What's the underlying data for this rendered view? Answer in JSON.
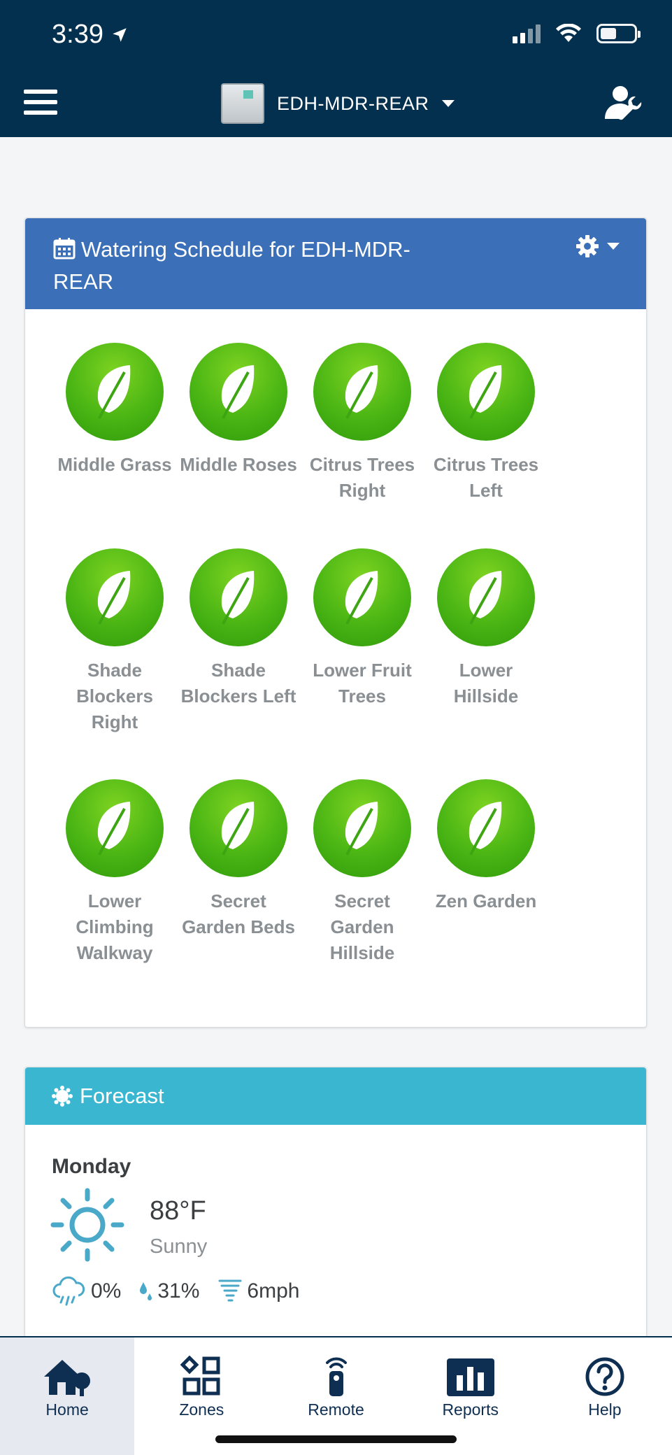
{
  "status_bar": {
    "time": "3:39"
  },
  "nav": {
    "controller_name": "EDH-MDR-REAR"
  },
  "schedule": {
    "title": "Watering Schedule for EDH-MDR-REAR",
    "zones": [
      {
        "label": "Middle Grass"
      },
      {
        "label": "Middle Roses"
      },
      {
        "label": "Citrus Trees Right"
      },
      {
        "label": "Citrus Trees Left"
      },
      {
        "label": "Shade Blockers Right"
      },
      {
        "label": "Shade Blockers Left"
      },
      {
        "label": "Lower Fruit Trees"
      },
      {
        "label": "Lower Hillside"
      },
      {
        "label": "Lower Climbing Walkway"
      },
      {
        "label": "Secret Garden Beds"
      },
      {
        "label": "Secret Garden Hillside"
      },
      {
        "label": "Zen Garden"
      }
    ]
  },
  "forecast": {
    "title": "Forecast",
    "day": "Monday",
    "temperature": "88°F",
    "condition": "Sunny",
    "precip": "0%",
    "humidity": "31%",
    "wind": "6mph"
  },
  "tabs": [
    {
      "label": "Home",
      "icon": "home-icon",
      "active": true
    },
    {
      "label": "Zones",
      "icon": "zones-icon"
    },
    {
      "label": "Remote",
      "icon": "remote-icon"
    },
    {
      "label": "Reports",
      "icon": "reports-icon"
    },
    {
      "label": "Help",
      "icon": "help-icon"
    }
  ],
  "colors": {
    "nav_bg": "#04304f",
    "schedule_header": "#3b6fb7",
    "forecast_header": "#3ab6d0",
    "zone_green": "#4ab514",
    "weather_icon": "#4aa8c8"
  }
}
